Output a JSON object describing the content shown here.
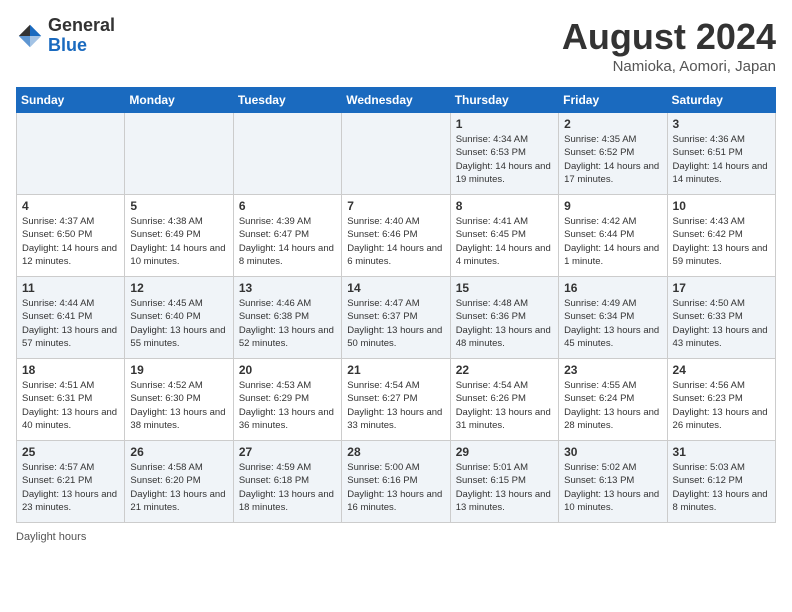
{
  "header": {
    "logo_general": "General",
    "logo_blue": "Blue",
    "title": "August 2024",
    "location": "Namioka, Aomori, Japan"
  },
  "days_of_week": [
    "Sunday",
    "Monday",
    "Tuesday",
    "Wednesday",
    "Thursday",
    "Friday",
    "Saturday"
  ],
  "weeks": [
    [
      {
        "day": "",
        "info": ""
      },
      {
        "day": "",
        "info": ""
      },
      {
        "day": "",
        "info": ""
      },
      {
        "day": "",
        "info": ""
      },
      {
        "day": "1",
        "info": "Sunrise: 4:34 AM\nSunset: 6:53 PM\nDaylight: 14 hours\nand 19 minutes."
      },
      {
        "day": "2",
        "info": "Sunrise: 4:35 AM\nSunset: 6:52 PM\nDaylight: 14 hours\nand 17 minutes."
      },
      {
        "day": "3",
        "info": "Sunrise: 4:36 AM\nSunset: 6:51 PM\nDaylight: 14 hours\nand 14 minutes."
      }
    ],
    [
      {
        "day": "4",
        "info": "Sunrise: 4:37 AM\nSunset: 6:50 PM\nDaylight: 14 hours\nand 12 minutes."
      },
      {
        "day": "5",
        "info": "Sunrise: 4:38 AM\nSunset: 6:49 PM\nDaylight: 14 hours\nand 10 minutes."
      },
      {
        "day": "6",
        "info": "Sunrise: 4:39 AM\nSunset: 6:47 PM\nDaylight: 14 hours\nand 8 minutes."
      },
      {
        "day": "7",
        "info": "Sunrise: 4:40 AM\nSunset: 6:46 PM\nDaylight: 14 hours\nand 6 minutes."
      },
      {
        "day": "8",
        "info": "Sunrise: 4:41 AM\nSunset: 6:45 PM\nDaylight: 14 hours\nand 4 minutes."
      },
      {
        "day": "9",
        "info": "Sunrise: 4:42 AM\nSunset: 6:44 PM\nDaylight: 14 hours\nand 1 minute."
      },
      {
        "day": "10",
        "info": "Sunrise: 4:43 AM\nSunset: 6:42 PM\nDaylight: 13 hours\nand 59 minutes."
      }
    ],
    [
      {
        "day": "11",
        "info": "Sunrise: 4:44 AM\nSunset: 6:41 PM\nDaylight: 13 hours\nand 57 minutes."
      },
      {
        "day": "12",
        "info": "Sunrise: 4:45 AM\nSunset: 6:40 PM\nDaylight: 13 hours\nand 55 minutes."
      },
      {
        "day": "13",
        "info": "Sunrise: 4:46 AM\nSunset: 6:38 PM\nDaylight: 13 hours\nand 52 minutes."
      },
      {
        "day": "14",
        "info": "Sunrise: 4:47 AM\nSunset: 6:37 PM\nDaylight: 13 hours\nand 50 minutes."
      },
      {
        "day": "15",
        "info": "Sunrise: 4:48 AM\nSunset: 6:36 PM\nDaylight: 13 hours\nand 48 minutes."
      },
      {
        "day": "16",
        "info": "Sunrise: 4:49 AM\nSunset: 6:34 PM\nDaylight: 13 hours\nand 45 minutes."
      },
      {
        "day": "17",
        "info": "Sunrise: 4:50 AM\nSunset: 6:33 PM\nDaylight: 13 hours\nand 43 minutes."
      }
    ],
    [
      {
        "day": "18",
        "info": "Sunrise: 4:51 AM\nSunset: 6:31 PM\nDaylight: 13 hours\nand 40 minutes."
      },
      {
        "day": "19",
        "info": "Sunrise: 4:52 AM\nSunset: 6:30 PM\nDaylight: 13 hours\nand 38 minutes."
      },
      {
        "day": "20",
        "info": "Sunrise: 4:53 AM\nSunset: 6:29 PM\nDaylight: 13 hours\nand 36 minutes."
      },
      {
        "day": "21",
        "info": "Sunrise: 4:54 AM\nSunset: 6:27 PM\nDaylight: 13 hours\nand 33 minutes."
      },
      {
        "day": "22",
        "info": "Sunrise: 4:54 AM\nSunset: 6:26 PM\nDaylight: 13 hours\nand 31 minutes."
      },
      {
        "day": "23",
        "info": "Sunrise: 4:55 AM\nSunset: 6:24 PM\nDaylight: 13 hours\nand 28 minutes."
      },
      {
        "day": "24",
        "info": "Sunrise: 4:56 AM\nSunset: 6:23 PM\nDaylight: 13 hours\nand 26 minutes."
      }
    ],
    [
      {
        "day": "25",
        "info": "Sunrise: 4:57 AM\nSunset: 6:21 PM\nDaylight: 13 hours\nand 23 minutes."
      },
      {
        "day": "26",
        "info": "Sunrise: 4:58 AM\nSunset: 6:20 PM\nDaylight: 13 hours\nand 21 minutes."
      },
      {
        "day": "27",
        "info": "Sunrise: 4:59 AM\nSunset: 6:18 PM\nDaylight: 13 hours\nand 18 minutes."
      },
      {
        "day": "28",
        "info": "Sunrise: 5:00 AM\nSunset: 6:16 PM\nDaylight: 13 hours\nand 16 minutes."
      },
      {
        "day": "29",
        "info": "Sunrise: 5:01 AM\nSunset: 6:15 PM\nDaylight: 13 hours\nand 13 minutes."
      },
      {
        "day": "30",
        "info": "Sunrise: 5:02 AM\nSunset: 6:13 PM\nDaylight: 13 hours\nand 10 minutes."
      },
      {
        "day": "31",
        "info": "Sunrise: 5:03 AM\nSunset: 6:12 PM\nDaylight: 13 hours\nand 8 minutes."
      }
    ]
  ],
  "legend": {
    "daylight_hours": "Daylight hours"
  }
}
